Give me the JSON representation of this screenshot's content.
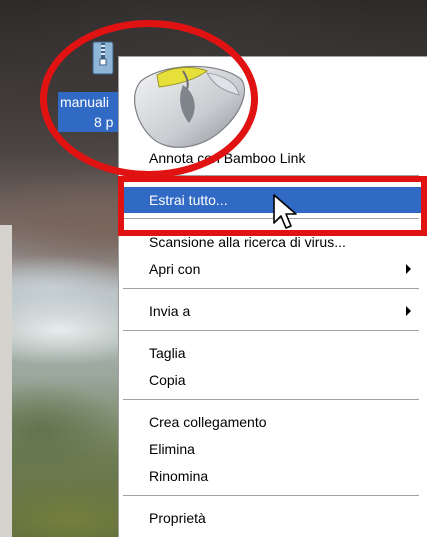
{
  "desktop_icon": {
    "label_line1": "manuali",
    "label_line2": "8 p",
    "icon": "zip-folder-icon"
  },
  "context_menu": {
    "header_art": "mouse-illustration",
    "items": [
      {
        "label": "Annota con Bamboo Link",
        "highlighted": false,
        "submenu": false
      },
      {
        "label": "Estrai tutto...",
        "highlighted": true,
        "submenu": false
      },
      {
        "label": "Scansione alla ricerca di virus...",
        "highlighted": false,
        "submenu": false
      },
      {
        "label": "Apri con",
        "highlighted": false,
        "submenu": true
      },
      {
        "label": "Invia a",
        "highlighted": false,
        "submenu": true
      },
      {
        "label": "Taglia",
        "highlighted": false,
        "submenu": false
      },
      {
        "label": "Copia",
        "highlighted": false,
        "submenu": false
      },
      {
        "label": "Crea collegamento",
        "highlighted": false,
        "submenu": false
      },
      {
        "label": "Elimina",
        "highlighted": false,
        "submenu": false
      },
      {
        "label": "Rinomina",
        "highlighted": false,
        "submenu": false
      },
      {
        "label": "Proprietà",
        "highlighted": false,
        "submenu": false
      }
    ]
  },
  "colors": {
    "highlight": "#316ac5",
    "annotation_red": "#e01212",
    "menu_bg": "#ffffff"
  }
}
